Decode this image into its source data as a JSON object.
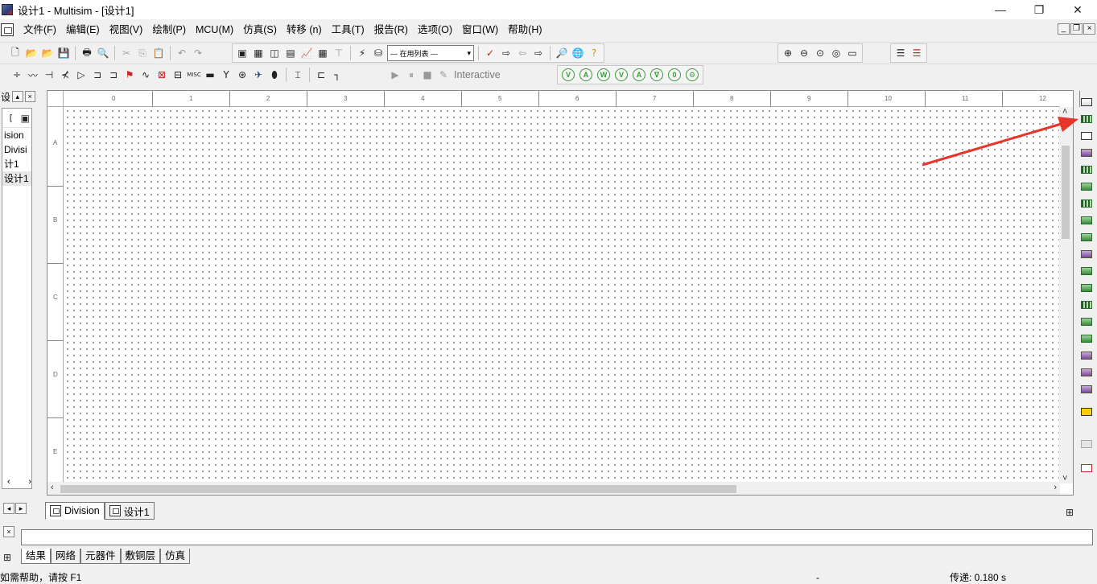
{
  "window": {
    "title": "设计1 - Multisim - [设计1]",
    "minimize": "—",
    "maximize": "❐",
    "close": "✕"
  },
  "menu": {
    "items": [
      "文件(F)",
      "编辑(E)",
      "视图(V)",
      "绘制(P)",
      "MCU(M)",
      "仿真(S)",
      "转移 (n)",
      "工具(T)",
      "报告(R)",
      "选项(O)",
      "窗口(W)",
      "帮助(H)"
    ],
    "mdi_min": "_",
    "mdi_restore": "❐",
    "mdi_close": "×"
  },
  "toolbar": {
    "in_use_list": "--- 在用列表 ---",
    "simulate_label": "Interactive"
  },
  "left_panel": {
    "title_fragment": "设",
    "items": [
      "ision",
      "Divisi",
      "计1",
      "设计1"
    ]
  },
  "ruler": {
    "x": [
      "0",
      "1",
      "2",
      "3",
      "4",
      "5",
      "6",
      "7",
      "8",
      "9",
      "10",
      "11",
      "12"
    ],
    "y": [
      "A",
      "B",
      "C",
      "D",
      "E"
    ]
  },
  "sheet_tabs": [
    "Division",
    "设计1"
  ],
  "spreadsheet_tabs": [
    "结果",
    "网络",
    "元器件",
    "敷铜层",
    "仿真"
  ],
  "status": {
    "help": "如需帮助，请按 F1",
    "mid": "-",
    "transfer": "传递: 0.180 s"
  }
}
